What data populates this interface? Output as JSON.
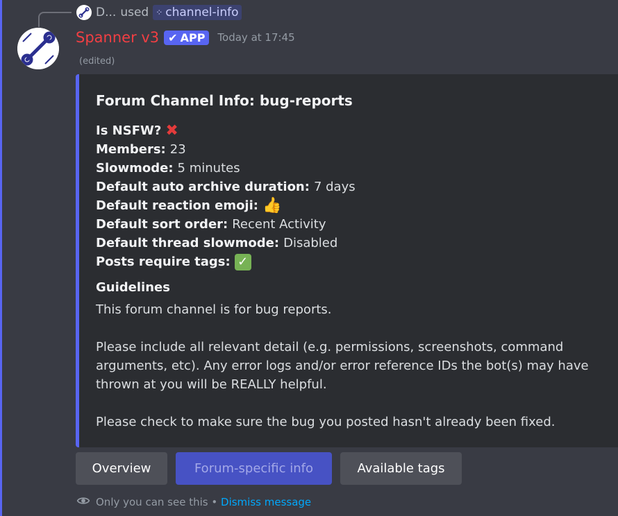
{
  "reply": {
    "user": "D...",
    "action": "used",
    "command_icon": "slash-command-icon",
    "command": "channel-info"
  },
  "header": {
    "username": "Spanner v3",
    "badge": "APP",
    "timestamp": "Today at 17:45",
    "edited": "(edited)"
  },
  "embed": {
    "title": "Forum Channel Info: bug-reports",
    "fields": [
      {
        "label": "Is NSFW?",
        "value": "",
        "icon": "red-x-icon"
      },
      {
        "label": "Members:",
        "value": "23"
      },
      {
        "label": "Slowmode:",
        "value": "5 minutes"
      },
      {
        "label": "Default auto archive duration:",
        "value": "7 days"
      },
      {
        "label": "Default reaction emoji:",
        "value": "",
        "icon": "thumbs-up-icon"
      },
      {
        "label": "Default sort order:",
        "value": "Recent Activity"
      },
      {
        "label": "Default thread slowmode:",
        "value": "Disabled"
      },
      {
        "label": "Posts require tags:",
        "value": "",
        "icon": "green-check-icon"
      }
    ],
    "guidelines": {
      "name": "Guidelines",
      "p1": "This forum channel is for bug reports.",
      "p2": "Please include all relevant detail (e.g. permissions, screenshots, command arguments, etc). Any error logs and/or error reference IDs the bot(s) may have thrown at you will be REALLY helpful.",
      "p3": "Please check to make sure the bug you posted hasn't already been fixed."
    },
    "accent_color": "#5865f2"
  },
  "buttons": [
    {
      "label": "Overview",
      "style": "secondary"
    },
    {
      "label": "Forum-specific info",
      "style": "primary-disabled"
    },
    {
      "label": "Available tags",
      "style": "secondary"
    }
  ],
  "ephemeral": {
    "notice": "Only you can see this",
    "separator": "•",
    "dismiss": "Dismiss message"
  },
  "colors": {
    "username": "#f23f43",
    "blurple": "#5865f2",
    "link": "#00a8fc"
  }
}
